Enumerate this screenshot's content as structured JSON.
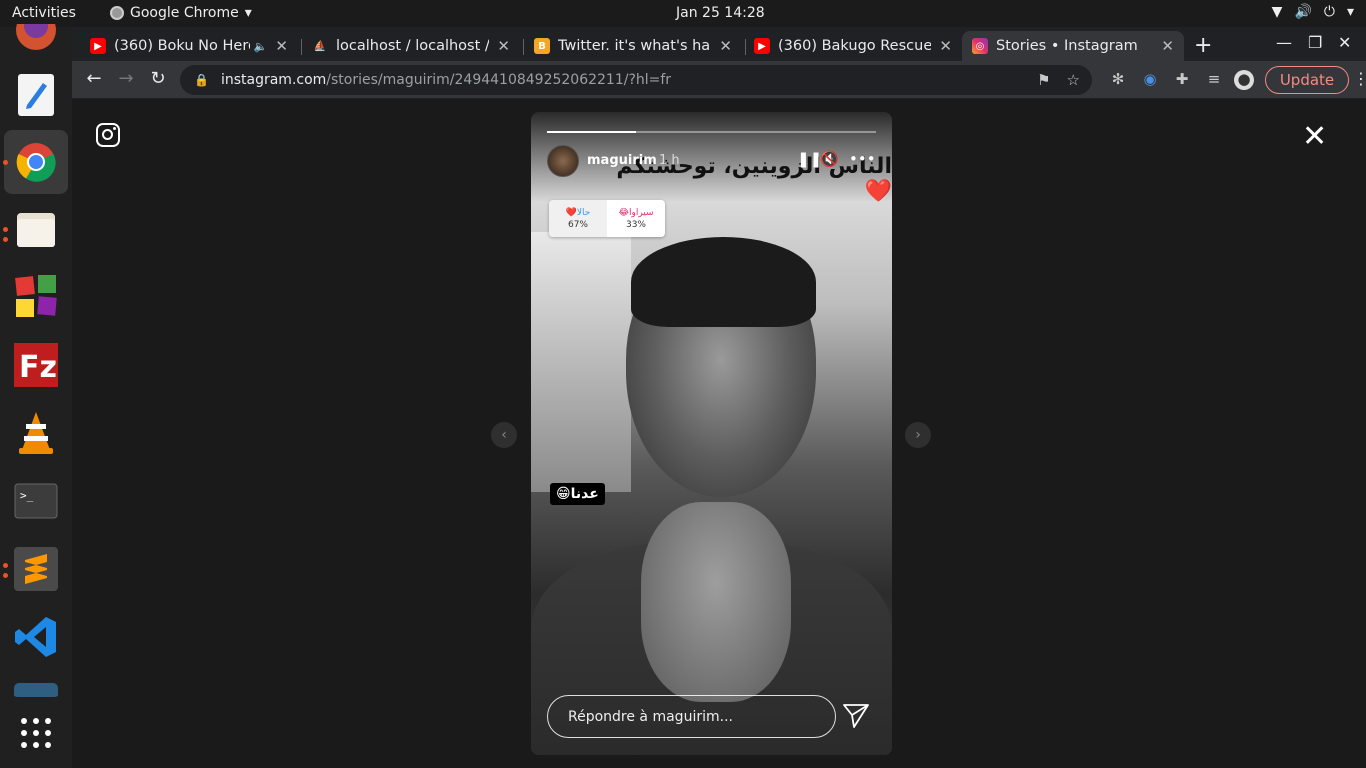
{
  "system": {
    "activities": "Activities",
    "app_name": "Google Chrome",
    "clock": "Jan 25  14:28"
  },
  "browser": {
    "tabs": [
      {
        "title": "(360) Boku No Hero",
        "favicon": "youtube-icon",
        "audio": true
      },
      {
        "title": "localhost / localhost / l",
        "favicon": "phpmyadmin-icon"
      },
      {
        "title": "Twitter. it's what's hap",
        "favicon": "twitter-icon"
      },
      {
        "title": "(360) Bakugo Rescue O",
        "favicon": "youtube-icon"
      },
      {
        "title": "Stories • Instagram",
        "favicon": "instagram-icon",
        "active": true
      }
    ],
    "url_host": "instagram.com",
    "url_path": "/stories/maguirim/2494410849252062211/?hl=fr",
    "update_label": "Update",
    "update_color": "#f28b82"
  },
  "story": {
    "username": "maguirim",
    "time_ago": "1 h",
    "overlay_text": "الناس الزوينين، توحشتكم❤️",
    "poll": {
      "left_label": "❤️حالا",
      "left_percent": "67%",
      "right_label": "😂سيراوا",
      "right_percent": "33%"
    },
    "sticker_text": "عدنا😁",
    "reply_placeholder": "Répondre à maguirim...",
    "progress": 0.27
  }
}
